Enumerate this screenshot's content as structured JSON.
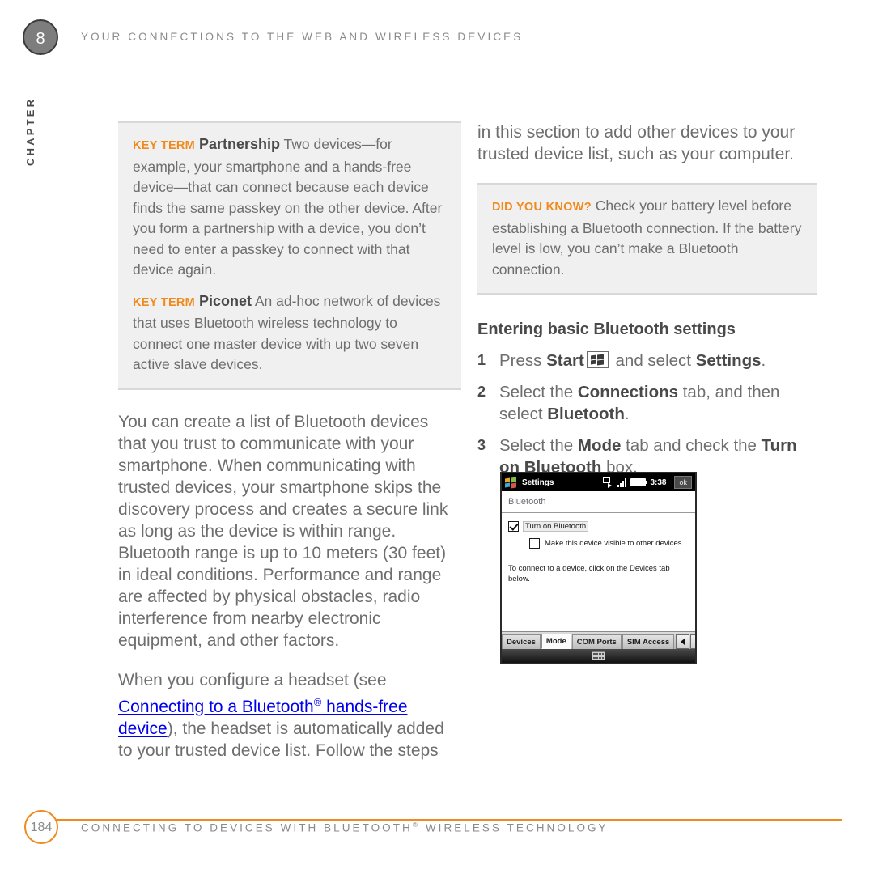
{
  "header": {
    "chapter_number": "8",
    "running_head": "YOUR CONNECTIONS TO THE WEB AND WIRELESS DEVICES",
    "chapter_label": "CHAPTER"
  },
  "left_column": {
    "note_box": {
      "notes": [
        {
          "tag": "KEY TERM",
          "term": "Partnership",
          "text": "Two devices—for example, your smartphone and a hands-free device—that can connect because each device finds the same passkey on the other device. After you form a partnership with a device, you don’t need to enter a passkey to connect with that device again."
        },
        {
          "tag": "KEY TERM",
          "term": "Piconet",
          "text": "An ad-hoc network of devices that uses Bluetooth wireless technology to connect one master device with up two seven active slave devices."
        }
      ]
    },
    "paragraph_1": "You can create a list of Bluetooth devices that you trust to communicate with your smartphone. When communicating with trusted devices, your smartphone skips the discovery process and creates a secure link as long as the device is within range. Bluetooth range is up to 10 meters (30 feet) in ideal conditions. Performance and range are affected by physical obstacles, radio interference from nearby electronic equipment, and other factors.",
    "paragraph_2": {
      "before_link": "When you configure a headset (see ",
      "link_text_a": "Connecting to a Bluetooth",
      "link_sup": "®",
      "link_text_b": " hands-free device",
      "after_link": "), the headset is automatically added to your trusted device list. Follow the steps"
    }
  },
  "right_column": {
    "paragraph_continuation": "in this section to add other devices to your trusted device list, such as your computer.",
    "note_box": {
      "tag": "DID YOU KNOW?",
      "text": "Check your battery level before establishing a Bluetooth connection. If the battery level is low, you can’t make a Bluetooth connection."
    },
    "section_heading": "Entering basic Bluetooth settings",
    "steps": [
      {
        "number": "1",
        "parts": [
          {
            "type": "text",
            "value": "Press "
          },
          {
            "type": "bold",
            "value": "Start"
          },
          {
            "type": "icon",
            "value": "windows-start-icon"
          },
          {
            "type": "text",
            "value": " and select "
          },
          {
            "type": "bold",
            "value": "Settings"
          },
          {
            "type": "text",
            "value": "."
          }
        ],
        "plain": "Press Start and select Settings."
      },
      {
        "number": "2",
        "parts": [
          {
            "type": "text",
            "value": "Select the "
          },
          {
            "type": "bold",
            "value": "Connections"
          },
          {
            "type": "text",
            "value": " tab, and then select "
          },
          {
            "type": "bold",
            "value": "Bluetooth"
          },
          {
            "type": "text",
            "value": "."
          }
        ],
        "plain": "Select the Connections tab, and then select Bluetooth."
      },
      {
        "number": "3",
        "parts": [
          {
            "type": "text",
            "value": "Select the "
          },
          {
            "type": "bold",
            "value": "Mode"
          },
          {
            "type": "text",
            "value": " tab and check the "
          },
          {
            "type": "bold",
            "value": "Turn on Bluetooth"
          },
          {
            "type": "text",
            "value": " box."
          }
        ],
        "plain": "Select the Mode tab and check the Turn on Bluetooth box."
      }
    ]
  },
  "phone_screenshot": {
    "titlebar": {
      "app_icon": "windows-flag-icon",
      "title": "Settings",
      "status_icons": [
        "sync-icon",
        "signal-strength-icon",
        "battery-icon"
      ],
      "clock": "3:38",
      "ok_button": "ok"
    },
    "subheader": "Bluetooth",
    "checkboxes": [
      {
        "label": "Turn on Bluetooth",
        "checked": true,
        "selected": true
      },
      {
        "label": "Make this device visible to other devices",
        "checked": false,
        "selected": false
      }
    ],
    "hint_text": "To connect to a device, click on the Devices tab below.",
    "tabs": [
      {
        "label": "Devices",
        "active": false
      },
      {
        "label": "Mode",
        "active": true
      },
      {
        "label": "COM Ports",
        "active": false
      },
      {
        "label": "SIM Access",
        "active": false
      }
    ],
    "tab_arrows": [
      "arrow-left-icon",
      "arrow-right-icon"
    ],
    "softkey_icon": "keyboard-icon"
  },
  "footer": {
    "page_number": "184",
    "title_before_sup": "CONNECTING TO DEVICES WITH BLUETOOTH",
    "title_sup": "®",
    "title_after_sup": " WIRELESS TECHNOLOGY"
  },
  "colors": {
    "accent_orange": "#f08a1c",
    "note_box_bg": "#f0f0f0",
    "body_text": "#6e6e6e",
    "bold_text": "#4a4a4a",
    "chapter_badge_bg": "#7d7d7d"
  }
}
